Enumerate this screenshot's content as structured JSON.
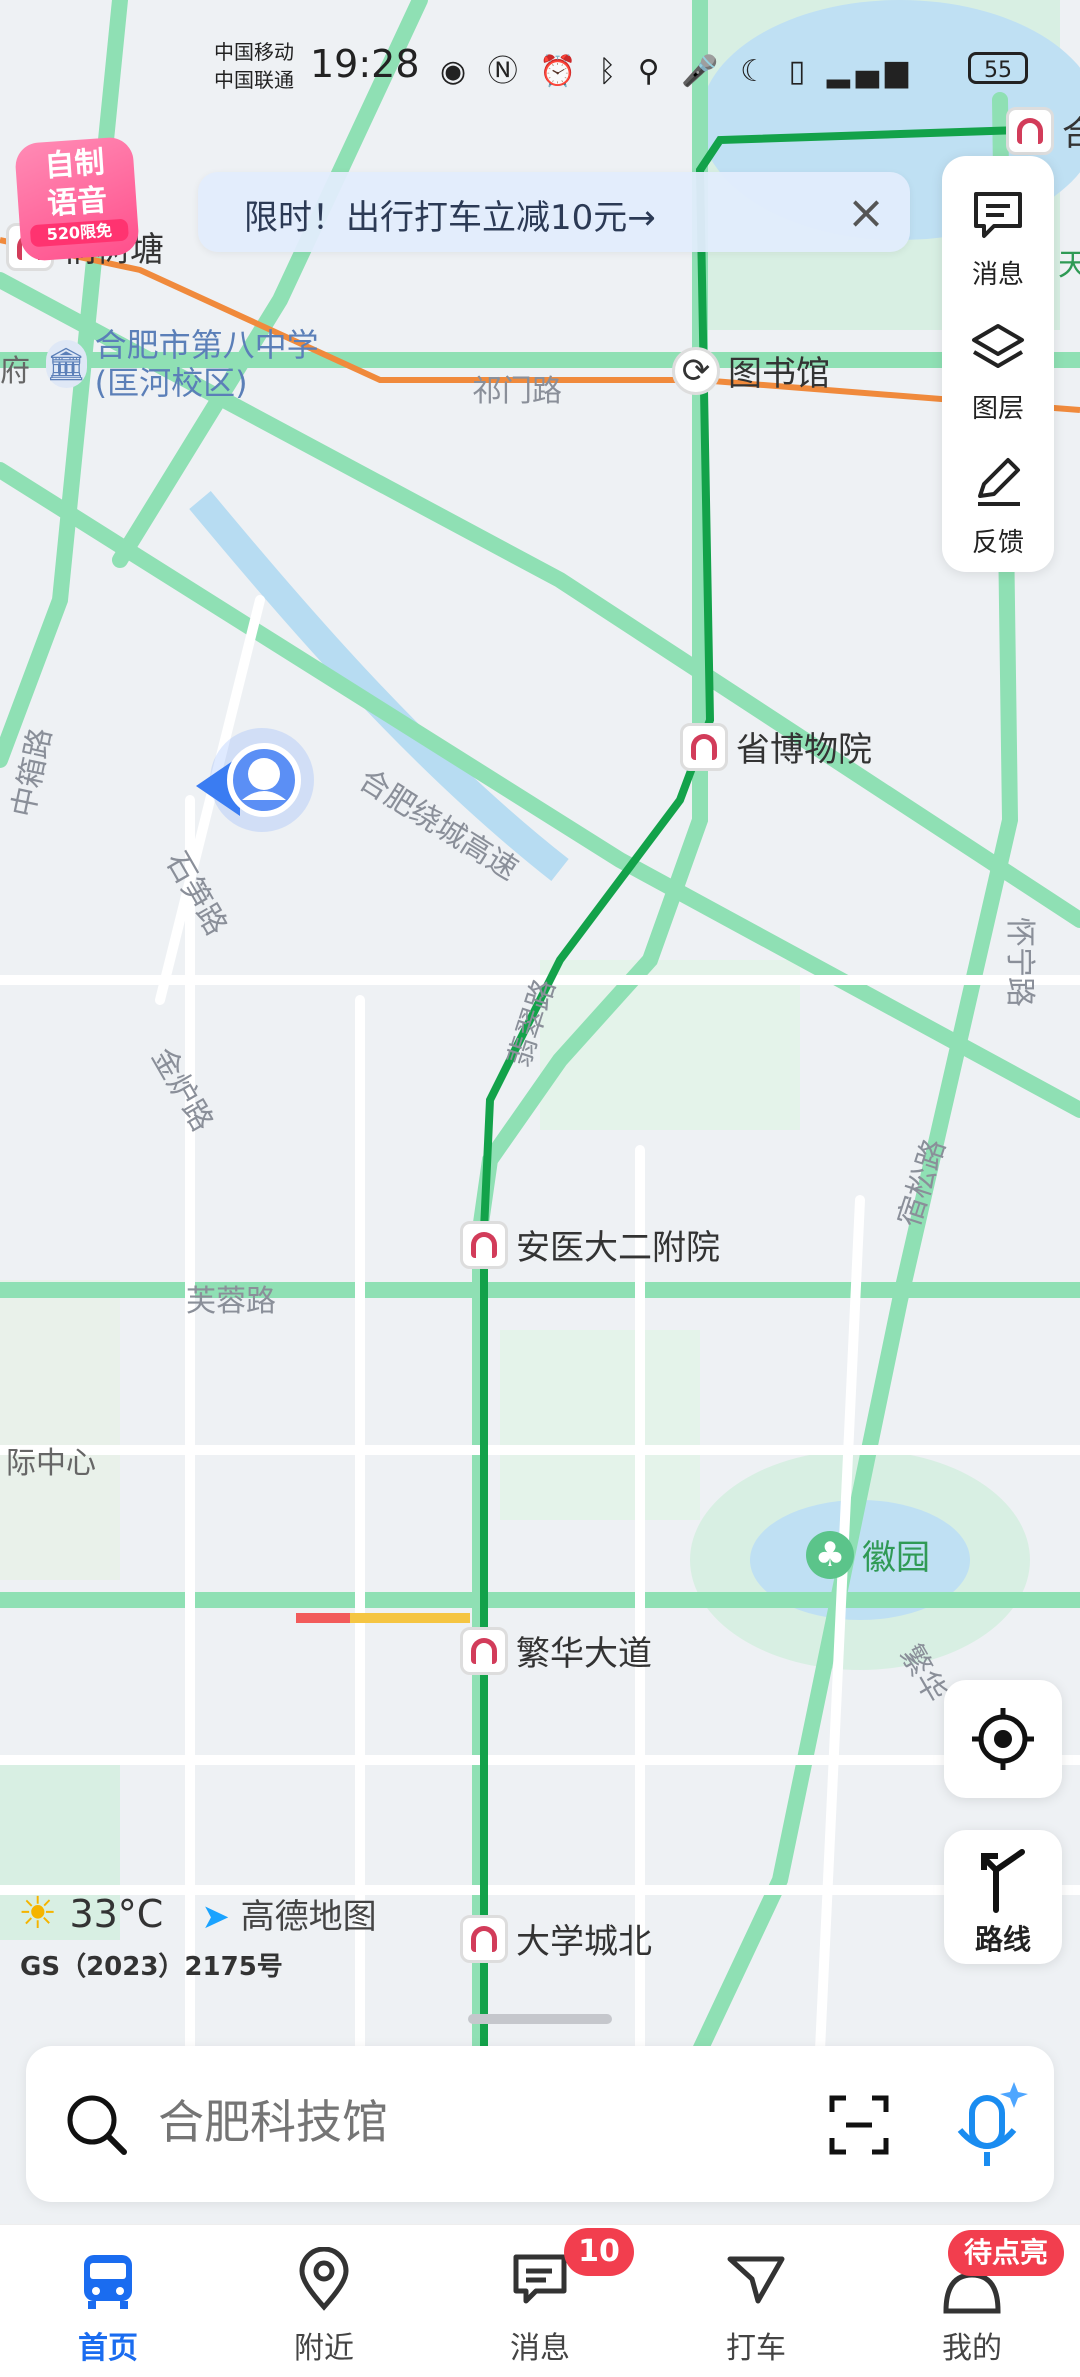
{
  "status_bar": {
    "carrier_1": "中国移动",
    "carrier_2": "中国联通",
    "time": "19:28",
    "battery": "55"
  },
  "promo_banner": {
    "text": "限时！出行打车立减10元→"
  },
  "voice_badge": {
    "line1": "自制",
    "line2": "语音",
    "sub": "520限免"
  },
  "side_panel": {
    "messages": "消息",
    "layers": "图层",
    "feedback": "反馈"
  },
  "map": {
    "pois": [
      {
        "label": "图书馆",
        "type": "transfer"
      },
      {
        "label": "省博物院",
        "type": "metro"
      },
      {
        "label": "安医大二附院",
        "type": "metro"
      },
      {
        "label": "繁华大道",
        "type": "metro"
      },
      {
        "label": "大学城北",
        "type": "metro"
      },
      {
        "label": "合",
        "type": "metro"
      },
      {
        "label": "桐树塘",
        "type": "metro"
      }
    ],
    "places": [
      {
        "label": "合肥市第八中学(匡河校区)"
      },
      {
        "label": "徽园"
      },
      {
        "label": "际中心"
      },
      {
        "label": "府"
      },
      {
        "label": "天"
      }
    ],
    "roads": [
      {
        "label": "祁门路"
      },
      {
        "label": "合肥绕城高速"
      },
      {
        "label": "石笋路"
      },
      {
        "label": "金炉路"
      },
      {
        "label": "中箱路"
      },
      {
        "label": "翡翠路"
      },
      {
        "label": "怀宁路"
      },
      {
        "label": "芙蓉路"
      },
      {
        "label": "宿松路"
      },
      {
        "label": "繁华"
      }
    ]
  },
  "weather": {
    "temp": "33°C",
    "brand": "高德地图",
    "license": "GS（2023）2175号"
  },
  "floating_buttons": {
    "route": "路线"
  },
  "search": {
    "placeholder": "合肥科技馆"
  },
  "tabbar": {
    "tabs": [
      {
        "label": "首页",
        "active": true
      },
      {
        "label": "附近"
      },
      {
        "label": "消息",
        "badge": "10"
      },
      {
        "label": "打车"
      },
      {
        "label": "我的",
        "badge": "待点亮"
      }
    ]
  },
  "colors": {
    "road_green": "#8fe0b4",
    "metro_line": "#13a24a",
    "metro_orange": "#f08a3c",
    "accent": "#1a6cf0",
    "badge_red": "#f23e4e"
  }
}
